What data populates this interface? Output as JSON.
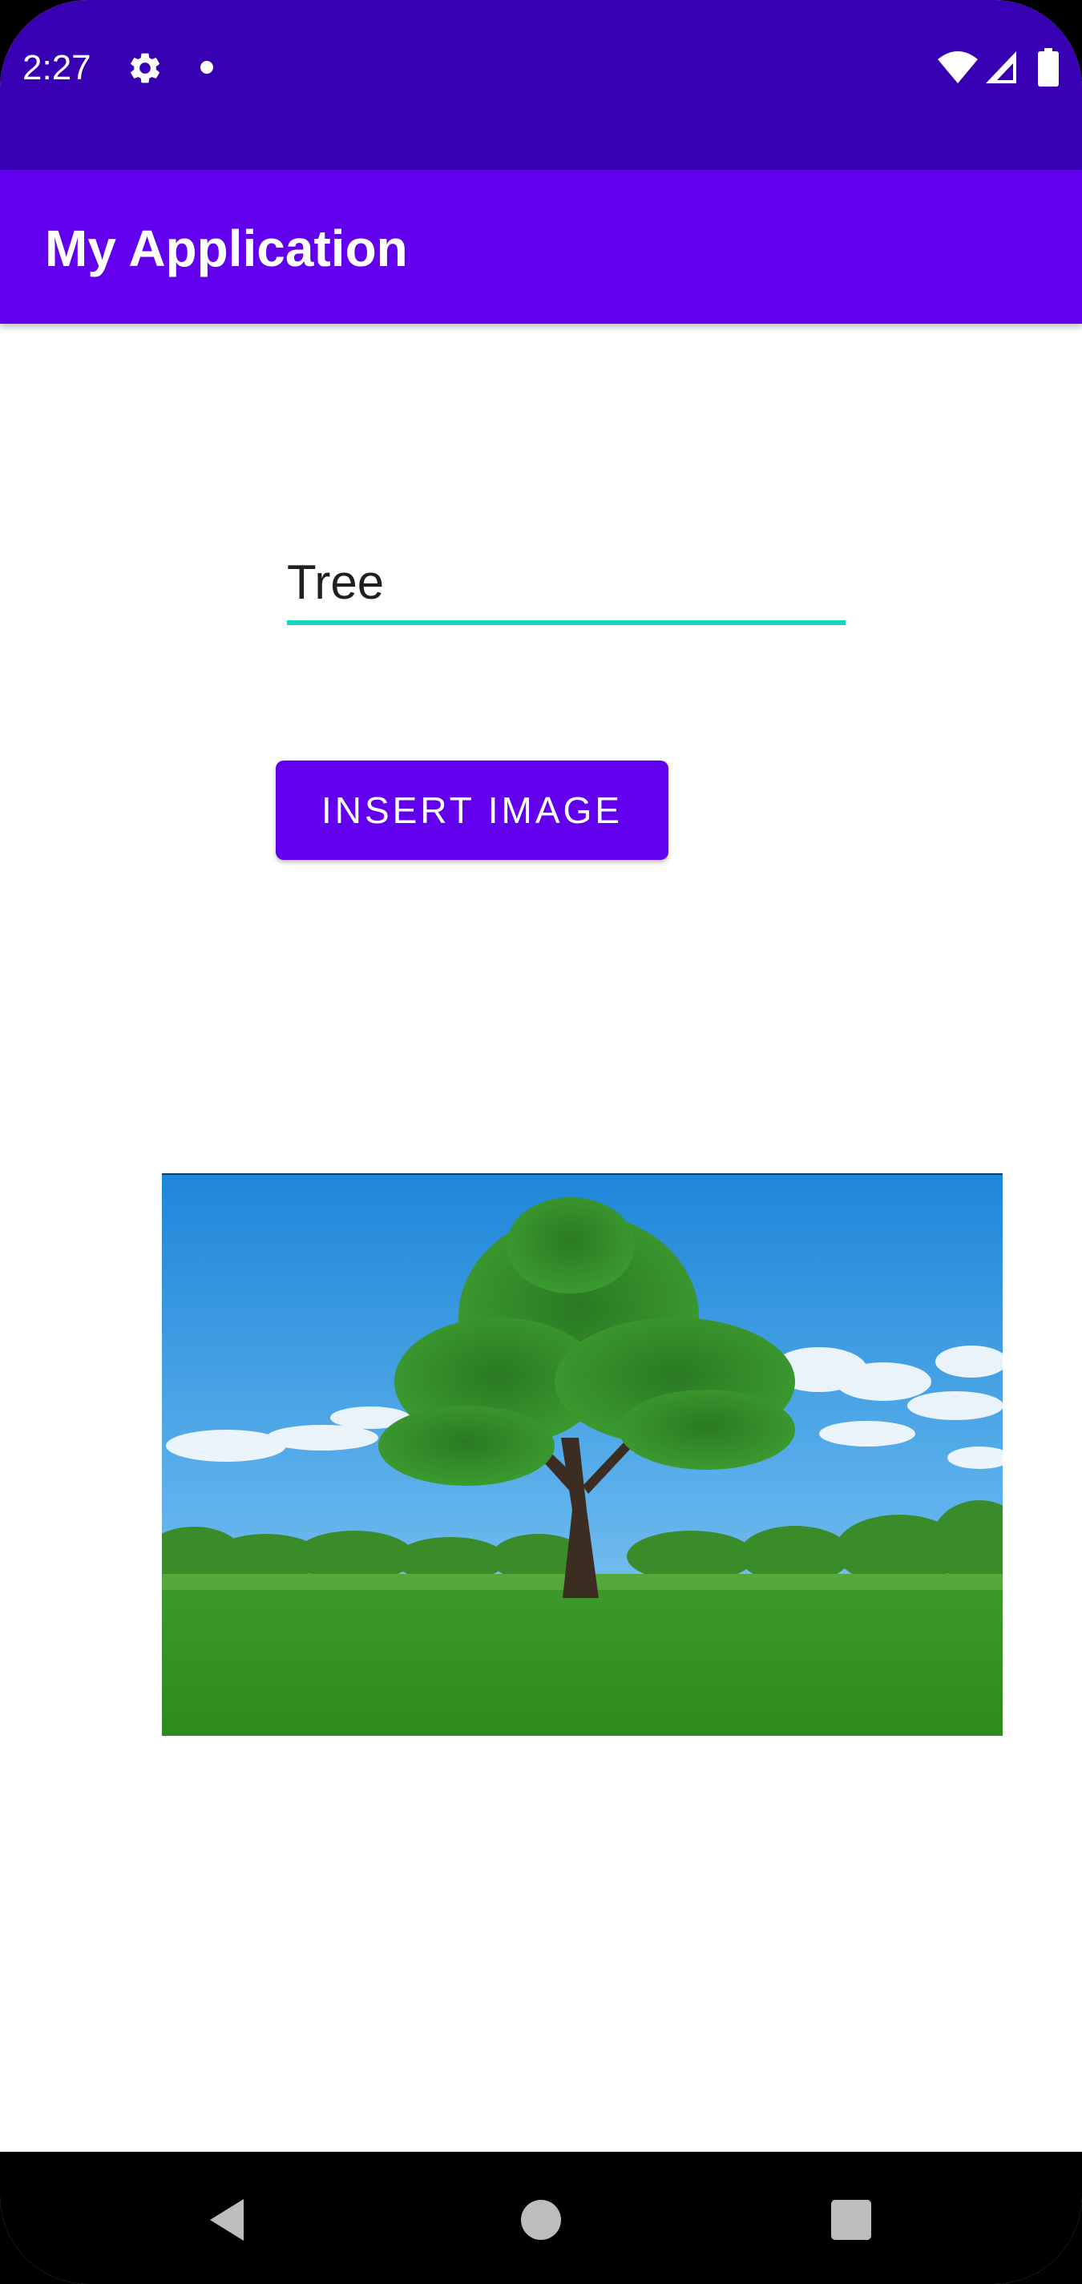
{
  "status_bar": {
    "time": "2:27",
    "background": "#3700b3",
    "icons": [
      "gear-icon",
      "notification-dot-icon",
      "wifi-icon",
      "signal-icon",
      "battery-icon"
    ]
  },
  "app_bar": {
    "title": "My Application",
    "background": "#6200ee"
  },
  "form": {
    "text_input_value": "Tree",
    "underline_color": "#18d6c3",
    "insert_button_label": "INSERT IMAGE",
    "button_color": "#6200ee"
  },
  "image": {
    "alt": "Tree"
  },
  "nav_bar": {
    "icons": [
      "back-icon",
      "home-icon",
      "recents-icon"
    ]
  }
}
